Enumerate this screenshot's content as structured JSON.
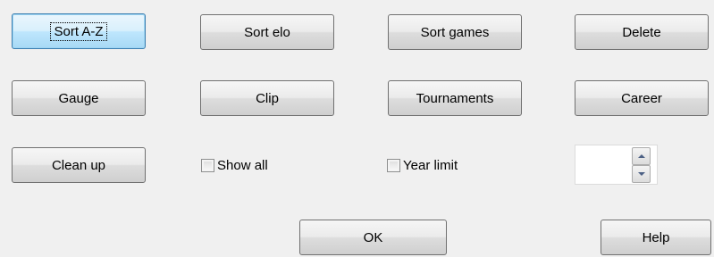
{
  "buttons": {
    "sort_az": "Sort A-Z",
    "sort_elo": "Sort elo",
    "sort_games": "Sort games",
    "delete": "Delete",
    "gauge": "Gauge",
    "clip": "Clip",
    "tournaments": "Tournaments",
    "career": "Career",
    "clean_up": "Clean up",
    "ok": "OK",
    "help": "Help"
  },
  "options": {
    "show_all": {
      "label": "Show all",
      "checked": false
    },
    "year_limit": {
      "label": "Year limit",
      "checked": false
    }
  },
  "year_spinner": {
    "value": "",
    "up_icon": "arrow-up-icon",
    "down_icon": "arrow-down-icon"
  },
  "colors": {
    "dialog_bg": "#f0f0f0",
    "default_button_border": "#3c7fb1",
    "spin_arrow": "#4d6185"
  }
}
